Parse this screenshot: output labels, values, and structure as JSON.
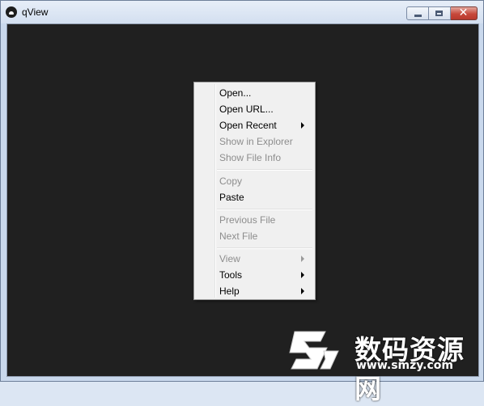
{
  "window": {
    "title": "qView",
    "icon": "qview-app-icon",
    "controls": {
      "minimize_icon": "minimize-icon",
      "maximize_icon": "maximize-icon",
      "close_glyph": "✕"
    }
  },
  "context_menu": {
    "items": [
      {
        "label": "Open...",
        "enabled": true,
        "submenu": false
      },
      {
        "label": "Open URL...",
        "enabled": true,
        "submenu": false
      },
      {
        "label": "Open Recent",
        "enabled": true,
        "submenu": true
      },
      {
        "label": "Show in Explorer",
        "enabled": false,
        "submenu": false
      },
      {
        "label": "Show File Info",
        "enabled": false,
        "submenu": false
      },
      {
        "label": "Copy",
        "enabled": false,
        "submenu": false
      },
      {
        "label": "Paste",
        "enabled": true,
        "submenu": false
      },
      {
        "label": "Previous File",
        "enabled": false,
        "submenu": false
      },
      {
        "label": "Next File",
        "enabled": false,
        "submenu": false
      },
      {
        "label": "View",
        "enabled": false,
        "submenu": true
      },
      {
        "label": "Tools",
        "enabled": true,
        "submenu": true
      },
      {
        "label": "Help",
        "enabled": true,
        "submenu": true
      }
    ]
  },
  "watermark": {
    "text": "数码资源网",
    "url": "www.smzy.com"
  },
  "colors": {
    "viewer_background": "#202020",
    "menu_background": "#f0f0f0",
    "disabled_text": "#8d8d8d"
  }
}
